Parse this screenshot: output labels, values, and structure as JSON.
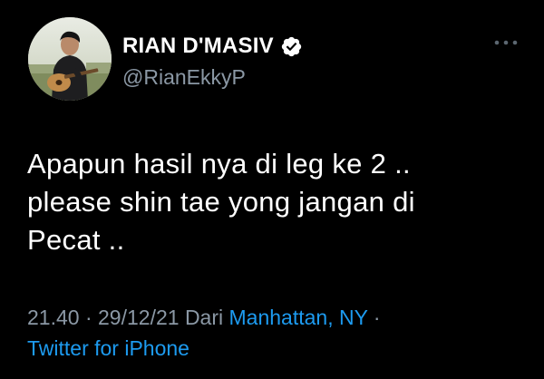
{
  "author": {
    "display_name": "RIAN D'MASIV",
    "handle": "@RianEkkyP",
    "verified_icon": "verified-badge-icon",
    "avatar_icon": "profile-photo-icon"
  },
  "more_icon": "more-options-icon",
  "tweet": {
    "lines": [
      "Apapun hasil nya di leg ke 2 ..",
      "please shin tae yong jangan di",
      "Pecat .."
    ]
  },
  "meta": {
    "time": "21.40",
    "separator": "·",
    "date": "29/12/21",
    "from_label": "Dari",
    "location": "Manhattan, NY",
    "separator2": "·",
    "client": "Twitter for iPhone"
  },
  "colors": {
    "background": "#000000",
    "text": "#ffffff",
    "secondary": "#8b98a5",
    "accent": "#1d9bf0"
  }
}
